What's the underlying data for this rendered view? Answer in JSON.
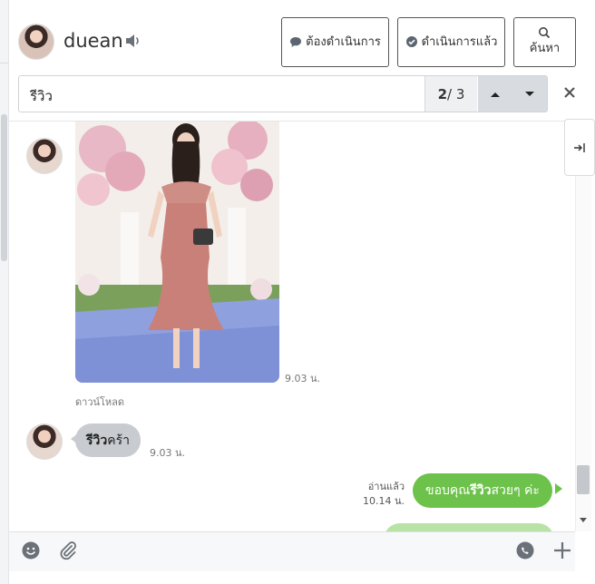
{
  "header": {
    "contact_name": "duean",
    "buttons": {
      "todo_label": "ต้องดำเนินการ",
      "done_label": "ดำเนินการแล้ว",
      "search_label": "ค้นหา"
    }
  },
  "search": {
    "query": "รีวิว",
    "current": "2",
    "total": "/ 3"
  },
  "messages": [
    {
      "type": "image",
      "direction": "incoming",
      "time": "9.03 น.",
      "action": "ดาวน์โหลด"
    },
    {
      "type": "text",
      "direction": "incoming",
      "highlight": "รีวิว",
      "rest": "คร้า",
      "time": "9.03 น."
    },
    {
      "type": "text",
      "direction": "outgoing",
      "prefix": "ขอบคุณ",
      "highlight": "รีวิว",
      "suffix": "สวยๆ ค่ะ",
      "status": "อ่านแล้ว",
      "time": "10.14 น."
    }
  ],
  "colors": {
    "outgoing_bubble": "#6cc24a",
    "incoming_bubble": "#c8cbcf",
    "search_bg": "#eef0f2"
  },
  "icons": [
    "speaker-icon",
    "chat-bubble-icon",
    "check-circle-icon",
    "search-icon",
    "chevron-up-icon",
    "chevron-down-icon",
    "close-icon",
    "collapse-panel-icon",
    "emoji-icon",
    "paperclip-icon",
    "sticker-icon",
    "plus-icon"
  ]
}
